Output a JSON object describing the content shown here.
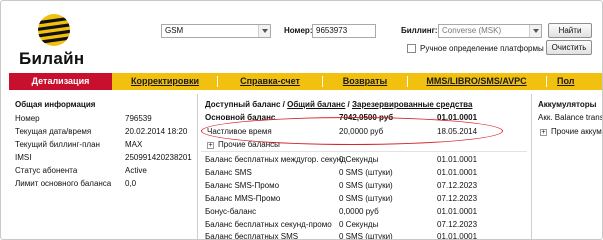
{
  "brand": {
    "name": "Билайн",
    "mark_color": "#f2c10f"
  },
  "header": {
    "region_select": "GSM",
    "number_label": "Номер:",
    "number_value": "9653973",
    "billing_label": "Биллинг:",
    "billing_select": "Converse (MSK)",
    "find_button": "Найти",
    "clear_button": "Очистить",
    "auto_platform_label": "Ручное определение платформы"
  },
  "tabs": [
    {
      "label": "Детализация",
      "active": true
    },
    {
      "label": "Корректировки"
    },
    {
      "label": "Справка-счет"
    },
    {
      "label": "Возвраты"
    },
    {
      "label": "MMS/LIBRO/SMS/AVPC"
    },
    {
      "label": "Пол"
    }
  ],
  "colors": {
    "tab_bar": "#f2c10f",
    "tab_active": "#c8102e",
    "highlight_oval": "#d6282c"
  },
  "general": {
    "title": "Общая информация",
    "rows": [
      {
        "label": "Номер",
        "value": "796539"
      },
      {
        "label": "Текущая дата/время",
        "value": "20.02.2014 18:20"
      },
      {
        "label": "Текущий биллинг-план",
        "value": "MAX"
      },
      {
        "label": "IMSI",
        "value": "250991420238201"
      },
      {
        "label": "Статус абонента",
        "value": "Active"
      },
      {
        "label": "Лимит основного баланса",
        "value": "0,0"
      }
    ]
  },
  "balances": {
    "title_prefix": "Доступный баланс /",
    "link_general": "Общий баланс",
    "separator": "/",
    "link_reserved": "Зарезервированные средства",
    "main": {
      "label": "Основной баланс",
      "amount": "7042,0500 руб",
      "date": "01.01.0001"
    },
    "highlight": {
      "label": "Частливое время",
      "amount": "20,0000 руб",
      "date": "18.05.2014"
    },
    "other_toggle": "Прочие балансы",
    "rows": [
      {
        "label": "Баланс бесплатных междугор. секунд",
        "amount": "0 Секунды",
        "date": "01.01.0001"
      },
      {
        "label": "Баланс SMS",
        "amount": "0 SMS (штуки)",
        "date": "01.01.0001"
      },
      {
        "label": "Баланс SMS-Промо",
        "amount": "0 SMS (штуки)",
        "date": "07.12.2023"
      },
      {
        "label": "Баланс MMS-Промо",
        "amount": "0 SMS (штуки)",
        "date": "07.12.2023"
      },
      {
        "label": "Бонус-баланс",
        "amount": "0,0000 руб",
        "date": "01.01.0001"
      },
      {
        "label": "Баланс бесплатных секунд-промо",
        "amount": "0 Секунды",
        "date": "07.12.2023"
      },
      {
        "label": "Баланс бесплатных SMS",
        "amount": "0 SMS (штуки)",
        "date": "01.01.0001"
      }
    ]
  },
  "accumulators": {
    "title": "Аккумуляторы",
    "row1": "Акк. Balance trans",
    "other_toggle": "Прочие аккум"
  }
}
